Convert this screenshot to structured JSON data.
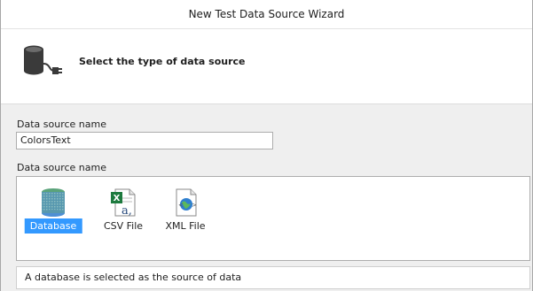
{
  "window": {
    "title": "New Test Data Source Wizard"
  },
  "header": {
    "title": "Select the type of data source",
    "icon": "database-plug-icon"
  },
  "form": {
    "name_label": "Data source name",
    "name_value": "ColorsText",
    "types_label": "Data source name"
  },
  "types": [
    {
      "label": "Database",
      "icon": "database-icon",
      "selected": true
    },
    {
      "label": "CSV File",
      "icon": "csv-file-icon",
      "selected": false
    },
    {
      "label": "XML File",
      "icon": "xml-file-icon",
      "selected": false
    }
  ],
  "status": {
    "text": "A database is selected as the source of data"
  },
  "colors": {
    "selection": "#3399ff",
    "excel_green": "#1d7a3e",
    "globe_blue": "#2f7fcf"
  }
}
